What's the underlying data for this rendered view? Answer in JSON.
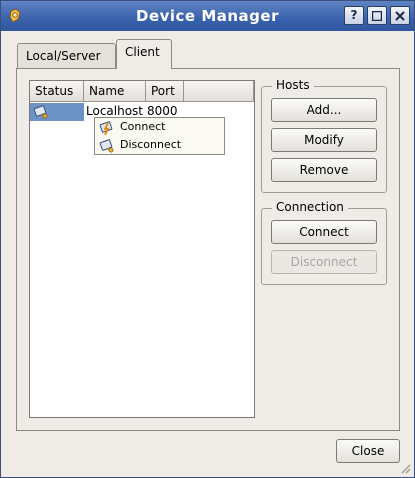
{
  "window": {
    "title": "Device Manager",
    "help_label": "?",
    "maximize_label": "□",
    "close_label": "✕"
  },
  "tabs": [
    {
      "label": "Local/Server"
    },
    {
      "label": "Client"
    }
  ],
  "host_list": {
    "columns": [
      "Status",
      "Name",
      "Port"
    ],
    "rows": [
      {
        "name": "Localhost",
        "port": "8000"
      }
    ]
  },
  "context_menu": {
    "items": [
      {
        "label": "Connect",
        "icon": "connect-icon"
      },
      {
        "label": "Disconnect",
        "icon": "disconnect-icon"
      }
    ]
  },
  "hosts_group": {
    "title": "Hosts",
    "add_label": "Add...",
    "modify_label": "Modify",
    "remove_label": "Remove"
  },
  "connection_group": {
    "title": "Connection",
    "connect_label": "Connect",
    "disconnect_label": "Disconnect"
  },
  "footer": {
    "close_label": "Close"
  },
  "colors": {
    "titlebar": "#3c63ad",
    "selection": "#6d93c6"
  }
}
